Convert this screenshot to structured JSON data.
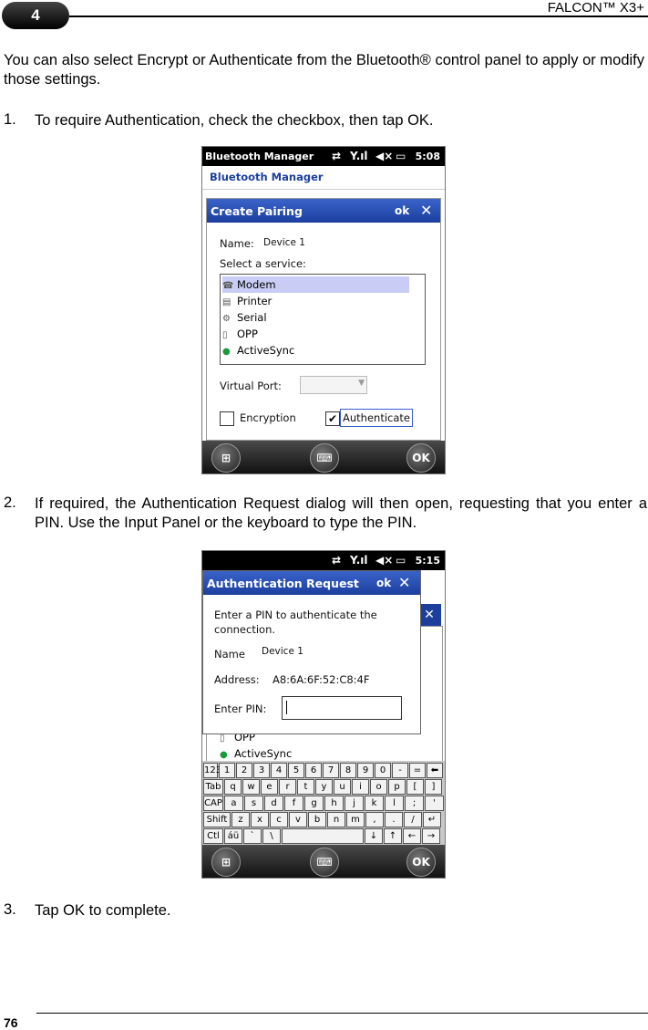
{
  "header": {
    "chapter": "4",
    "title": "FALCON™ X3+"
  },
  "intro": "You can also select Encrypt or Authenticate from the Bluetooth® control panel to apply or modify those settings.",
  "steps": [
    {
      "num": "1.",
      "text": "To require Authentication, check the checkbox, then tap OK."
    },
    {
      "num": "2.",
      "text": "If required, the Authentication Request dialog will then open, requesting that you enter a PIN. Use the Input Panel or the keyboard to type the PIN."
    },
    {
      "num": "3.",
      "text": "Tap OK to complete."
    }
  ],
  "footer": {
    "page": "76"
  },
  "screen1": {
    "status_title": "Bluetooth Manager",
    "time": "5:08",
    "app_title": "Bluetooth Manager",
    "dialog": {
      "title": "Create Pairing",
      "ok": "ok",
      "name_label": "Name:",
      "name_value": "Device 1",
      "service_label": "Select a service:",
      "services": [
        "Modem",
        "Printer",
        "Serial",
        "OPP",
        "ActiveSync"
      ],
      "selected_service": "Modem",
      "virtual_port_label": "Virtual Port:",
      "encryption_label": "Encryption",
      "encryption_checked": false,
      "authenticate_label": "Authenticate",
      "authenticate_checked": true
    },
    "ok_button": "OK"
  },
  "screen2": {
    "time": "5:15",
    "dialog": {
      "title": "Authentication Request",
      "ok": "ok",
      "message": "Enter a PIN to authenticate the connection.",
      "name_label": "Name",
      "name_value": "Device 1",
      "address_label": "Address:",
      "address_value": "A8:6A:6F:52:C8:4F",
      "pin_label": "Enter PIN:"
    },
    "background_services": [
      "OPP",
      "ActiveSync"
    ],
    "keyboard": [
      [
        "123",
        "1",
        "2",
        "3",
        "4",
        "5",
        "6",
        "7",
        "8",
        "9",
        "0",
        "-",
        "=",
        "⬅"
      ],
      [
        "Tab",
        "q",
        "w",
        "e",
        "r",
        "t",
        "y",
        "u",
        "i",
        "o",
        "p",
        "[",
        "]"
      ],
      [
        "CAP",
        "a",
        "s",
        "d",
        "f",
        "g",
        "h",
        "j",
        "k",
        "l",
        ";",
        "'"
      ],
      [
        "Shift",
        "z",
        "x",
        "c",
        "v",
        "b",
        "n",
        "m",
        ",",
        ".",
        "/",
        "↵"
      ],
      [
        "Ctl",
        "áü",
        "`",
        "\\",
        "",
        "↓",
        "↑",
        "←",
        "→"
      ]
    ],
    "ok_button": "OK"
  }
}
